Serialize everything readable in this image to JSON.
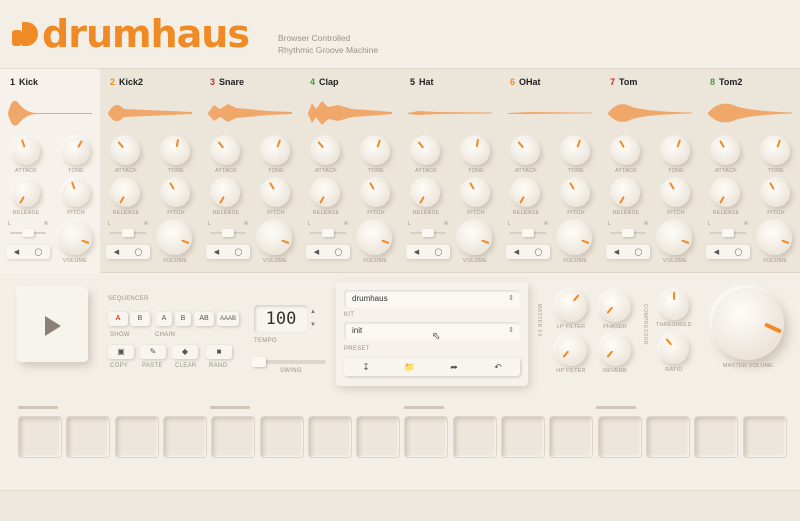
{
  "app": {
    "logo_text": "drumhaus",
    "tagline_1": "Browser Controlled",
    "tagline_2": "Rhythmic Groove Machine",
    "brand_color": "#f08a24"
  },
  "instruments": [
    {
      "num": "1",
      "name": "Kick",
      "num_color": "#222222"
    },
    {
      "num": "2",
      "name": "Kick2",
      "num_color": "#f08a24"
    },
    {
      "num": "3",
      "name": "Snare",
      "num_color": "#d7262c"
    },
    {
      "num": "4",
      "name": "Clap",
      "num_color": "#3aa13a"
    },
    {
      "num": "5",
      "name": "Hat",
      "num_color": "#222222"
    },
    {
      "num": "6",
      "name": "OHat",
      "num_color": "#f08a24"
    },
    {
      "num": "7",
      "name": "Tom",
      "num_color": "#d7262c"
    },
    {
      "num": "8",
      "name": "Tom2",
      "num_color": "#3aa13a"
    }
  ],
  "knob_labels": {
    "attack": "ATTACK",
    "tone": "TONE",
    "release": "RELEASE",
    "pitch": "PITCH",
    "volume": "VOLUME",
    "pan_l": "L",
    "pan_r": "R"
  },
  "sequencer": {
    "label": "SEQUENCER",
    "btn_a": "A",
    "btn_b": "B",
    "show_label": "SHOW",
    "chain_label": "CHAIN",
    "chain_a": "A",
    "chain_b": "B",
    "chain_ab": "AB",
    "chain_aaab": "AAAB",
    "copy_label": "COPY",
    "paste_label": "PASTE",
    "clear_label": "CLEAR",
    "rand_label": "RAND"
  },
  "tempo": {
    "value": "100",
    "label": "TEMPO",
    "swing_label": "SWING"
  },
  "kit_panel": {
    "preset_value": "drumhaus",
    "kit_label": "KIT",
    "kit_value": "init",
    "preset_label": "PRESET"
  },
  "master": {
    "lp_filter": "LP FILTER",
    "phaser": "PHASER",
    "hp_filter": "HP FILTER",
    "reverb": "REVERB",
    "threshold": "THRESHOLD",
    "ratio": "RATIO",
    "master_volume": "MASTER VOLUME",
    "master_fx_label": "MASTER FX",
    "compressor_label": "COMPRESSOR"
  },
  "steps_count": 16
}
